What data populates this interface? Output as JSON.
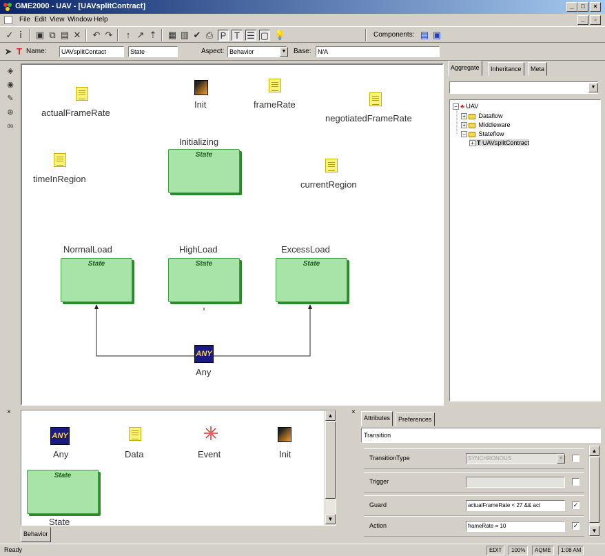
{
  "window": {
    "title": "GME2000 - UAV - [UAVsplitContract]",
    "minimize": "_",
    "restore": "□",
    "close": "×",
    "child_minimize": "_",
    "child_restore": "▫",
    "child_close": "×"
  },
  "menu": [
    "File",
    "Edit",
    "View",
    "Window",
    "Help"
  ],
  "toolbar": {
    "components_label": "Components:"
  },
  "namebar": {
    "name_label": "Name:",
    "name_value": "UAVsplitContact",
    "kind_value": "State",
    "aspect_label": "Aspect:",
    "aspect_value": "Behavior",
    "base_label": "Base:",
    "base_value": "N/A"
  },
  "canvas": {
    "data_nodes": [
      "actualFrameRate",
      "frameRate",
      "negotiatedFrameRate",
      "timeInRegion",
      "currentRegion"
    ],
    "init_label": "Init",
    "initializing_label": "Initializing",
    "states": [
      "NormalLoad",
      "HighLoad",
      "ExcessLoad"
    ],
    "state_tag": "State",
    "any_label": "Any",
    "any_icon_text": "ANY"
  },
  "browser": {
    "tabs": [
      "Aggregate",
      "Inheritance",
      "Meta"
    ],
    "tree": {
      "root": "UAV",
      "children": [
        "Dataflow",
        "Middleware",
        "Stateflow"
      ],
      "leaf": "UAVsplitContract"
    }
  },
  "parts": {
    "items": [
      "Any",
      "Data",
      "Event",
      "Init",
      "State"
    ],
    "any_icon_text": "ANY",
    "state_tag": "State",
    "tab": "Behavior"
  },
  "attributes": {
    "tabs": [
      "Attributes",
      "Preferences"
    ],
    "object_kind": "Transition",
    "rows": [
      {
        "label": "TransitionType",
        "value": "SYNCHRONOUS"
      },
      {
        "label": "Trigger",
        "value": ""
      },
      {
        "label": "Guard",
        "value": "actualFrameRate < 27 && act"
      },
      {
        "label": "Action",
        "value": "frameRate = 10"
      }
    ]
  },
  "status": {
    "ready": "Ready",
    "mode": "EDIT",
    "zoom": "100%",
    "paradigm": "AQME",
    "time": "1:08 AM"
  }
}
